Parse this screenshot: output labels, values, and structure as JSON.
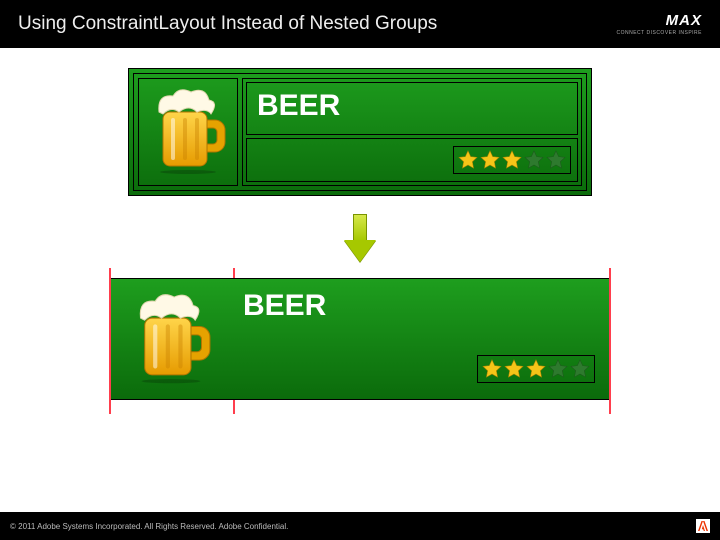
{
  "header": {
    "title": "Using ConstraintLayout Instead of Nested Groups",
    "logo": {
      "word": "MAX",
      "tag": "CONNECT DISCOVER INSPIRE"
    }
  },
  "card_a": {
    "title": "BEER",
    "rating": {
      "filled": 3,
      "total": 5
    },
    "icon_name": "beer-mug-icon"
  },
  "card_b": {
    "title": "BEER",
    "rating": {
      "filled": 3,
      "total": 5
    },
    "icon_name": "beer-mug-icon"
  },
  "colors": {
    "card_gradient_top": "#1e9e1e",
    "card_gradient_bottom": "#0b6b0b",
    "star_filled": "#f5c518",
    "star_empty": "#2e7a2e",
    "guide": "#ff3e4d"
  },
  "footer": {
    "copyright": "© 2011 Adobe Systems Incorporated. All Rights Reserved. Adobe Confidential."
  }
}
